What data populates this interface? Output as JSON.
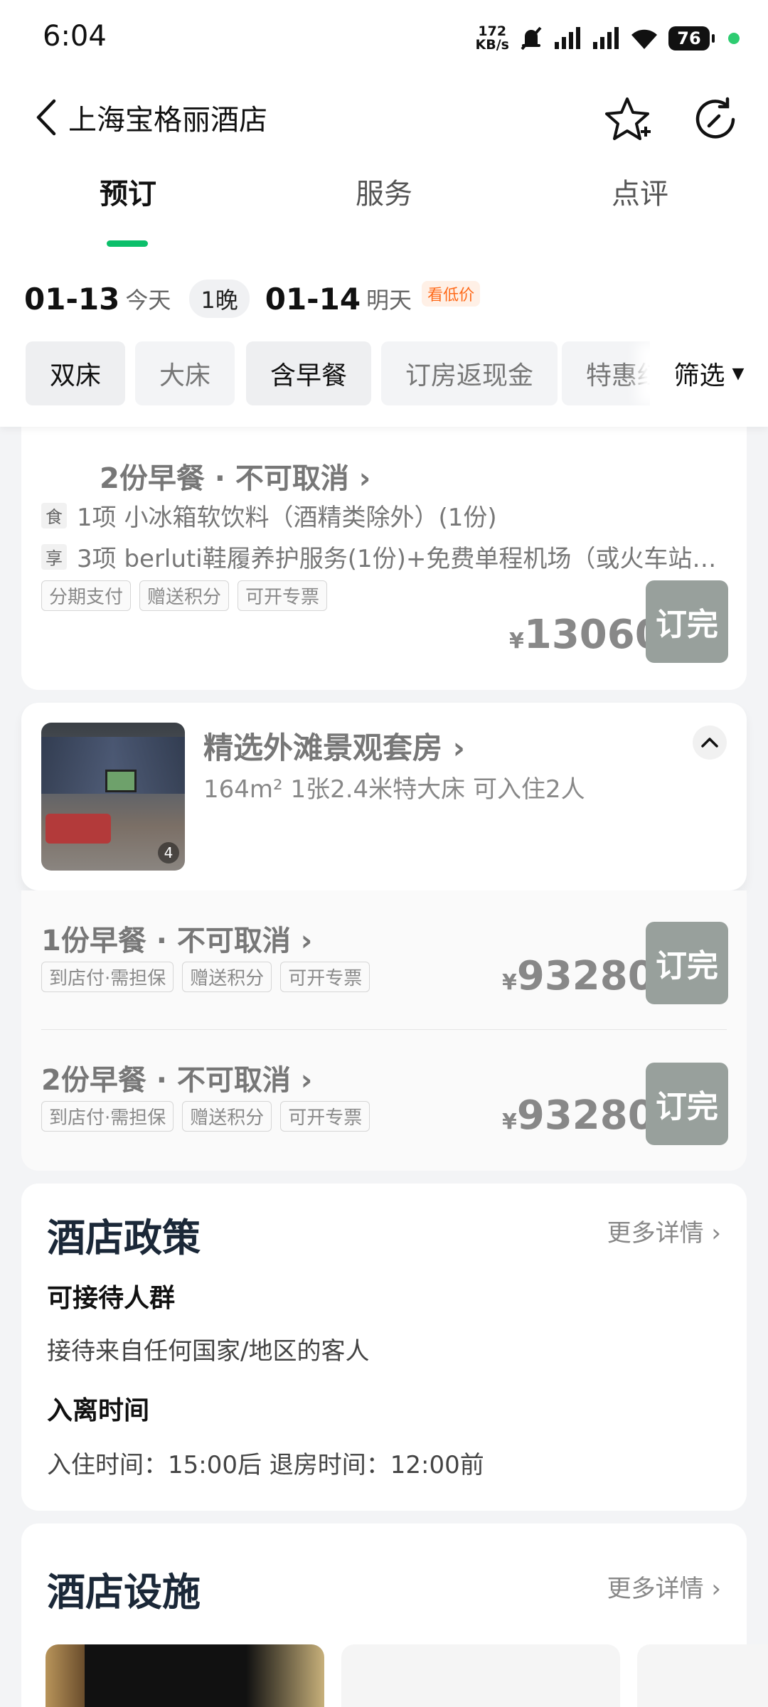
{
  "status": {
    "time": "6:04",
    "net_speed_value": "172",
    "net_speed_unit": "KB/s",
    "battery": "76"
  },
  "hotel": {
    "name": "上海宝格丽酒店"
  },
  "tabs": [
    {
      "label": "预订"
    },
    {
      "label": "服务"
    },
    {
      "label": "点评"
    }
  ],
  "dates": {
    "checkin": "01-13",
    "checkin_day": "今天",
    "nights": "1晚",
    "checkout": "01-14",
    "checkout_day": "明天",
    "badge": "看低价"
  },
  "filters": [
    "双床",
    "大床",
    "含早餐",
    "订房返现金",
    "特惠红"
  ],
  "filter_button": "筛选",
  "plan_top": {
    "title": "2份早餐 · 不可取消 ›",
    "perks": [
      {
        "icon": "食",
        "text": "1项 小冰箱软饮料（酒精类除外）(1份)"
      },
      {
        "icon": "享",
        "text": "3项 berluti鞋履养护服务(1份)+免费单程机场（或火车站…"
      }
    ],
    "tags": [
      "分期支付",
      "赠送积分",
      "可开专票"
    ],
    "currency": "¥",
    "price": "13060",
    "button": "订完"
  },
  "room": {
    "name": "精选外滩景观套房 ›",
    "details": "164m² 1张2.4米特大床 可入住2人",
    "photo_count": "4",
    "plans": [
      {
        "title": "1份早餐 · 不可取消 ›",
        "tags": [
          "到店付·需担保",
          "赠送积分",
          "可开专票"
        ],
        "currency": "¥",
        "price": "93280",
        "button": "订完"
      },
      {
        "title": "2份早餐 · 不可取消 ›",
        "tags": [
          "到店付·需担保",
          "赠送积分",
          "可开专票"
        ],
        "currency": "¥",
        "price": "93280",
        "button": "订完"
      }
    ]
  },
  "policy": {
    "title": "酒店政策",
    "more": "更多详情 ›",
    "guests_head": "可接待人群",
    "guests_text": "接待来自任何国家/地区的客人",
    "time_head": "入离时间",
    "time_text": "入住时间：15:00后 退房时间：12:00前"
  },
  "facilities": {
    "title": "酒店设施",
    "more": "更多详情 ›"
  },
  "colors": {
    "accent": "#0bbf6a",
    "sold_out": "#98a09c",
    "low_price": "#ff6a1a"
  }
}
